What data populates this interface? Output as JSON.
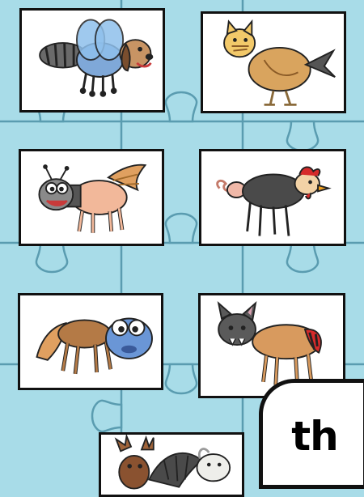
{
  "game": {
    "phonics_label": "th",
    "cards": [
      {
        "name": "card-bee-dog",
        "pieces": [
          "raccoon-tail",
          "bee-wings",
          "dog-head"
        ]
      },
      {
        "name": "card-cat-hen",
        "pieces": [
          "cat-head",
          "hen-body",
          "fish-tail"
        ]
      },
      {
        "name": "card-ant-horse",
        "pieces": [
          "ant-head",
          "horse-body",
          "fox-tail"
        ]
      },
      {
        "name": "card-pig-hen",
        "pieces": [
          "pig-tail",
          "spider-body",
          "hen-head"
        ]
      },
      {
        "name": "card-fox-fish",
        "pieces": [
          "fox-tail",
          "horse-body",
          "fish-head"
        ]
      },
      {
        "name": "card-bat-dog",
        "pieces": [
          "bat-head",
          "dog-body",
          "bee-stripes"
        ]
      },
      {
        "name": "card-moose-bat-goat",
        "pieces": [
          "moose-head",
          "bat-wings",
          "goat-head"
        ]
      }
    ]
  },
  "colors": {
    "background": "#a8dce8",
    "puzzle_line": "#5a9cb0",
    "card_border": "#111111",
    "badge_bg": "#ffffff",
    "badge_text": "#000000"
  }
}
